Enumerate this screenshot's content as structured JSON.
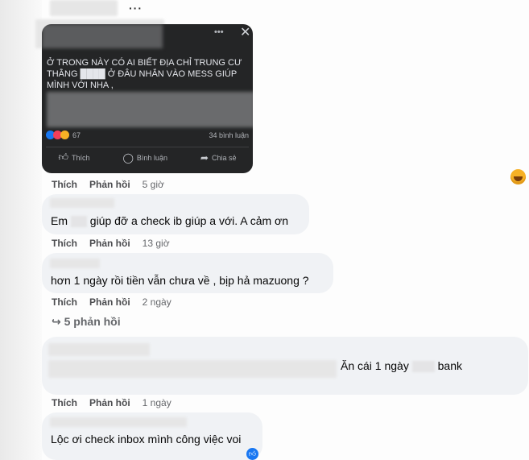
{
  "post": {
    "text": "Ở TRONG NÀY CÓ AI BIẾT ĐỊA CHỈ TRUNG CƯ THẰNG ████ Ở ĐÂU NHẮN VÀO MESS GIÚP MÌNH VỚI NHA ,",
    "reaction_count": "67",
    "comment_count": "34 bình luận",
    "actions": [
      "Thích",
      "Bình luận",
      "Chia sẻ"
    ]
  },
  "labels": {
    "like": "Thích",
    "reply": "Phản hồi"
  },
  "comments": [
    {
      "time": "5 giờ"
    },
    {
      "text_before": "Em",
      "text_after": "giúp đỡ a check ib giúp a với. A cảm ơn",
      "time": "13 giờ"
    },
    {
      "text": "hơn 1 ngày rồi tiền vẫn chưa về , bịp hả mazuong ?",
      "time": "2 ngày",
      "replies": "5 phản hồi"
    },
    {
      "text_a": "Ăn cái 1 ngày",
      "text_b": "bank",
      "time": "1 ngày"
    },
    {
      "text": "Lộc ơi check inbox mình công việc voi"
    }
  ],
  "colors": {
    "bubble": "#f0f2f5",
    "post_bg": "#242526",
    "muted": "#65676b",
    "like_blue": "#1877f2"
  }
}
